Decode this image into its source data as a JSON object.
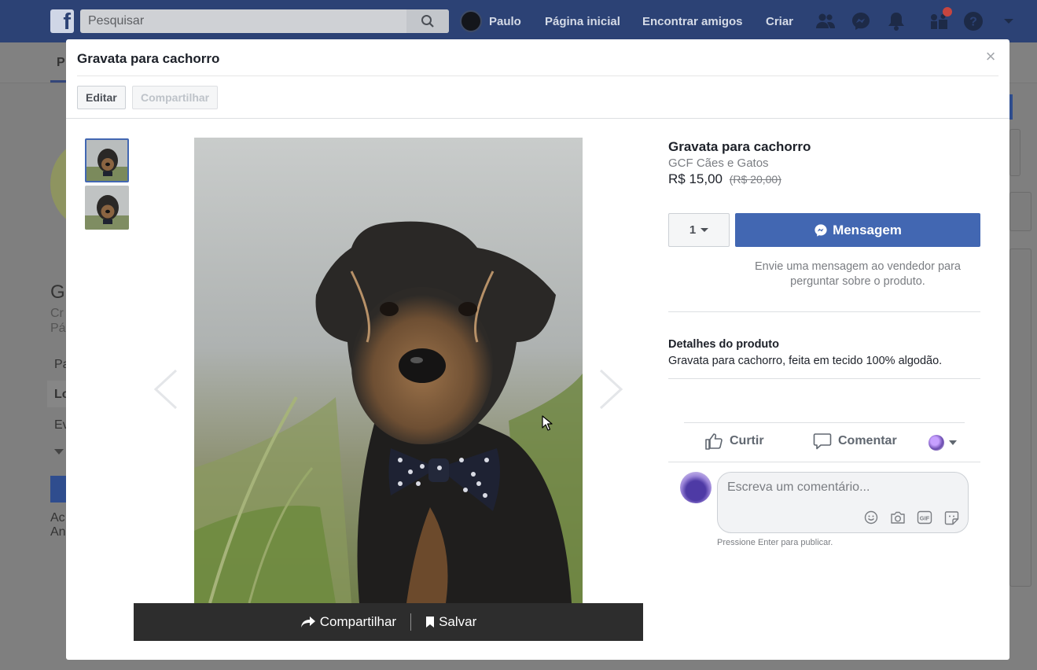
{
  "topbar": {
    "logo": "f",
    "search_placeholder": "Pesquisar",
    "user_name": "Paulo",
    "nav": [
      "Página inicial",
      "Encontrar amigos",
      "Criar"
    ]
  },
  "background_page": {
    "texts": [
      "P",
      "G",
      "Cr",
      "Pá",
      "Pa",
      "Lo",
      "Ev",
      "Ac",
      "An"
    ]
  },
  "modal": {
    "title": "Gravata para cachorro",
    "edit_label": "Editar",
    "share_label": "Compartilhar",
    "close_label": "×"
  },
  "image_bar": {
    "share_label": "Compartilhar",
    "save_label": "Salvar"
  },
  "product": {
    "title": "Gravata para cachorro",
    "seller": "GCF Cães e Gatos",
    "price": "R$ 15,00",
    "old_price": "(R$ 20,00)",
    "quantity": "1",
    "message_label": "Mensagem",
    "message_help": "Envie uma mensagem ao vendedor para perguntar sobre o produto.",
    "details_title": "Detalhes do produto",
    "details_text": "Gravata para cachorro, feita em tecido 100% algodão."
  },
  "actions": {
    "like_label": "Curtir",
    "comment_label": "Comentar"
  },
  "comment": {
    "placeholder": "Escreva um comentário...",
    "hint": "Pressione Enter para publicar."
  },
  "colors": {
    "topbar": "#2c4275",
    "accent": "#4267b2",
    "notification": "#c7453f"
  }
}
